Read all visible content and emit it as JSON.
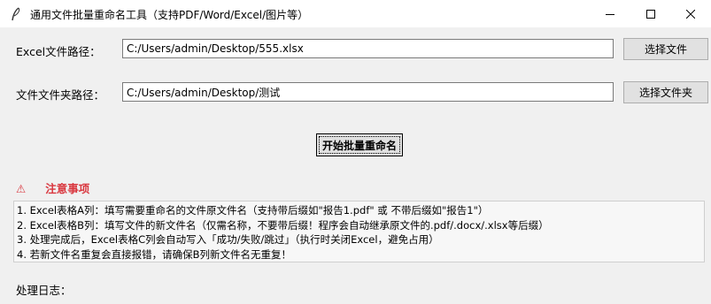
{
  "window": {
    "title": "通用文件批量重命名工具（支持PDF/Word/Excel/图片等）",
    "controls": {
      "minimize": "minimize-icon",
      "maximize": "maximize-icon",
      "close": "close-icon"
    }
  },
  "excel_path": {
    "label": "Excel文件路径：",
    "value": "C:/Users/admin/Desktop/555.xlsx",
    "button": "选择文件"
  },
  "folder_path": {
    "label": "文件文件夹路径：",
    "value": "C:/Users/admin/Desktop/测试",
    "button": "选择文件夹"
  },
  "start_button": "开始批量重命名",
  "notice": {
    "icon": "⚠",
    "heading": "注意事项",
    "color": "#d9363e",
    "lines": [
      "1. Excel表格A列：填写需要重命名的文件原文件名（支持带后缀如\"报告1.pdf\" 或 不带后缀如\"报告1\"）",
      "2. Excel表格B列：填写文件的新文件名（仅需名称，不要带后缀！程序会自动继承原文件的.pdf/.docx/.xlsx等后缀）",
      "3. 处理完成后，Excel表格C列会自动写入「成功/失败/跳过」（执行时关闭Excel，避免占用）",
      "4. 若新文件名重复会直接报错，请确保B列新文件名无重复！"
    ]
  },
  "log": {
    "label": "处理日志："
  }
}
